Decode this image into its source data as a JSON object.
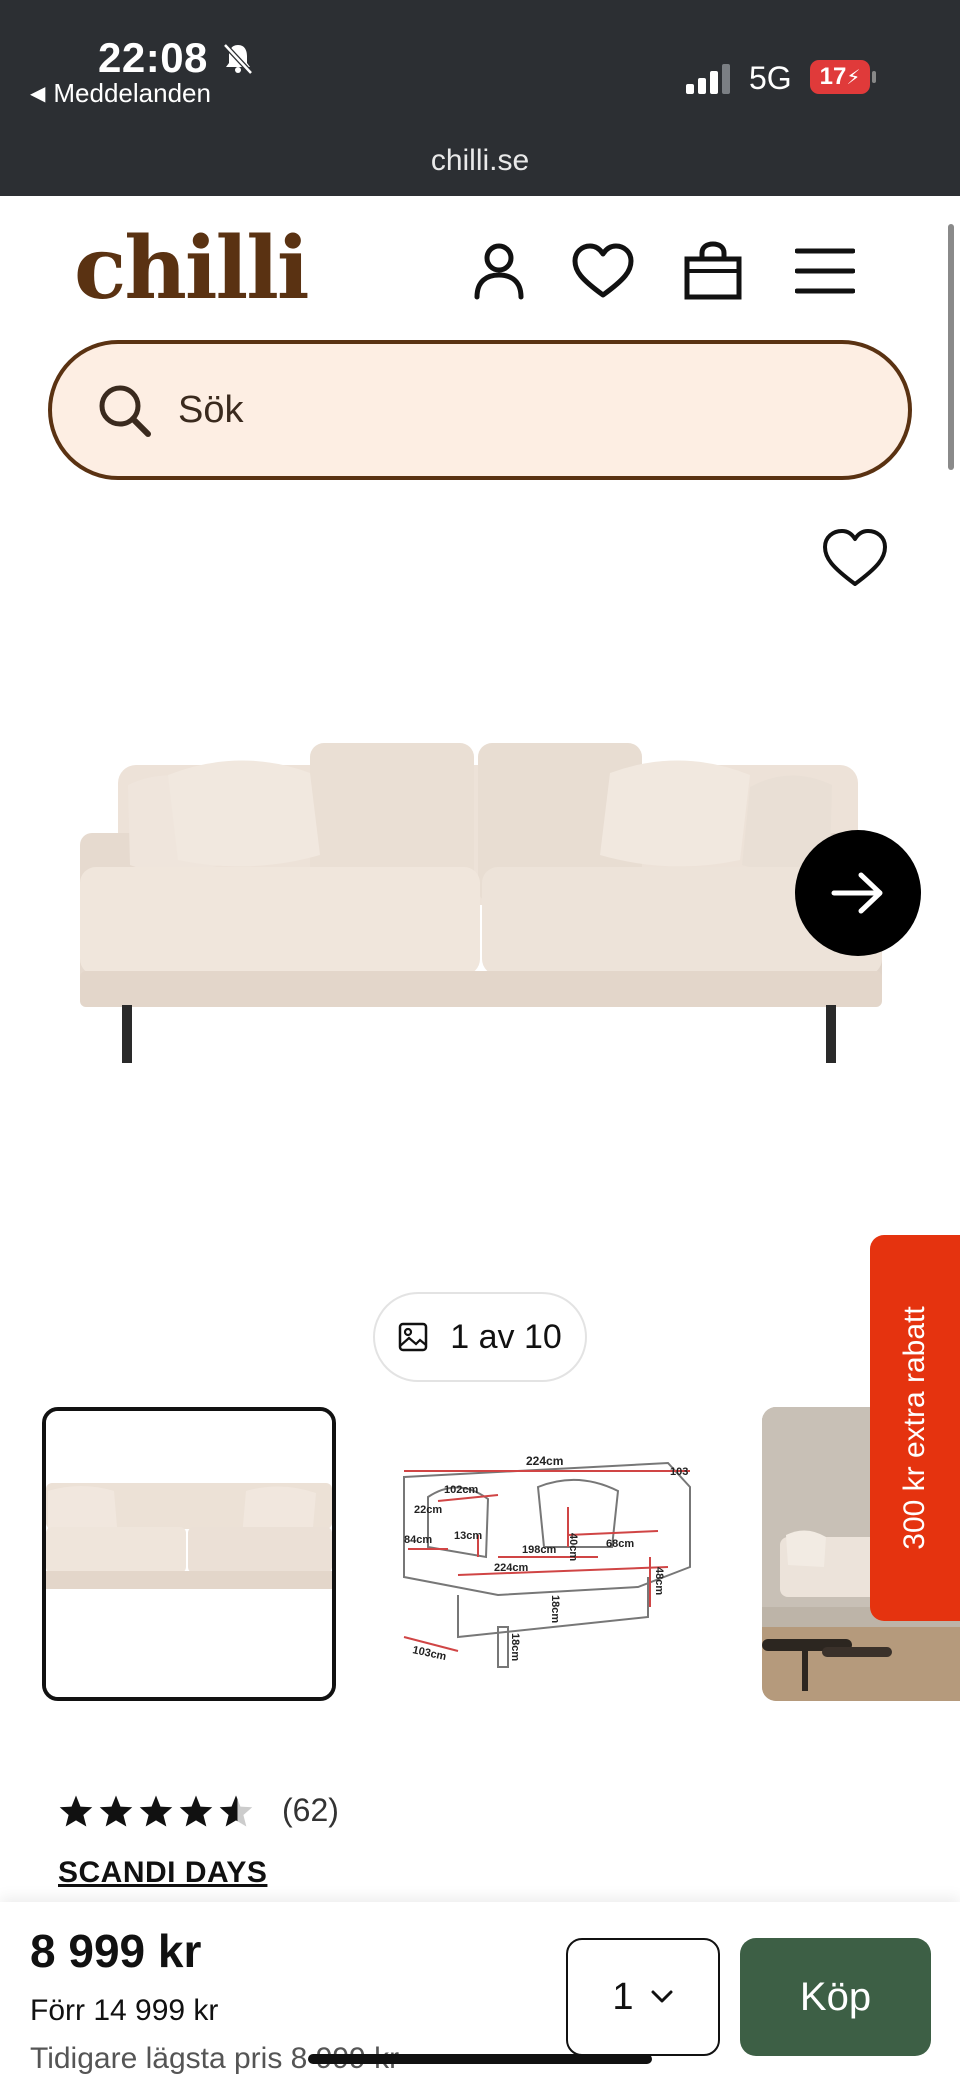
{
  "status_bar": {
    "time": "22:08",
    "back_app": "Meddelanden",
    "network": "5G",
    "battery": "17",
    "url": "chilli.se"
  },
  "header": {
    "logo": "chilli",
    "brand_color": "#5a3212",
    "icons": [
      "user-icon",
      "heart-icon",
      "bag-icon",
      "menu-icon"
    ]
  },
  "search": {
    "placeholder": "Sök",
    "background": "#fdeee3"
  },
  "gallery": {
    "counter": "1 av 10",
    "current": 1,
    "total": 10
  },
  "dimensions_thumb": {
    "labels": [
      "224cm",
      "103",
      "102cm",
      "22cm",
      "40cm",
      "84cm",
      "13cm",
      "198cm",
      "68cm",
      "224cm",
      "18cm",
      "48cm",
      "103cm",
      "18cm"
    ]
  },
  "promo": {
    "label": "300 kr extra rabatt",
    "color": "#e5330f"
  },
  "product": {
    "rating": 4.5,
    "rating_count": "(62)",
    "brand": "SCANDI DAYS"
  },
  "purchase": {
    "price": "8 999 kr",
    "before": "Förr 14 999 kr",
    "lowest": "Tidigare lägsta pris 8 999 kr",
    "quantity": "1",
    "buy_label": "Köp",
    "buy_color": "#3d5f45"
  }
}
